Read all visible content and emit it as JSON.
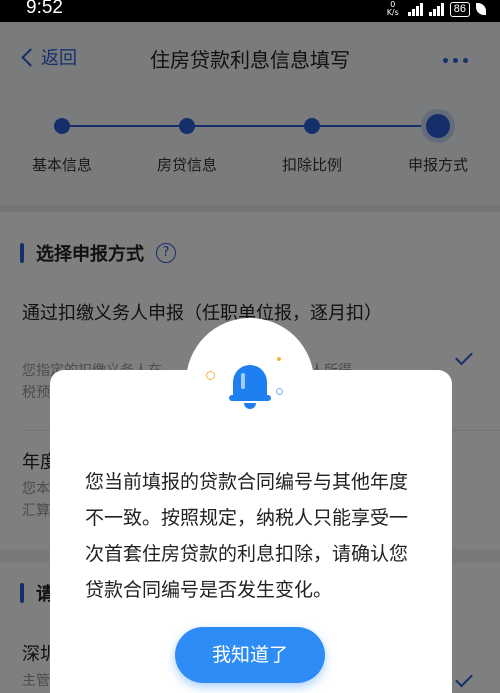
{
  "status_bar": {
    "time": "9:52",
    "net_speed_value": "0",
    "net_speed_unit": "K/s",
    "battery": "86"
  },
  "header": {
    "back_label": "返回",
    "title": "住房贷款利息信息填写"
  },
  "steps": [
    {
      "label": "基本信息",
      "state": "done"
    },
    {
      "label": "房贷信息",
      "state": "done"
    },
    {
      "label": "扣除比例",
      "state": "done"
    },
    {
      "label": "申报方式",
      "state": "current"
    }
  ],
  "section1": {
    "title": "选择申报方式",
    "help_glyph": "?"
  },
  "option1": {
    "title": "通过扣缴义务人申报（任职单位报，逐月扣）",
    "desc_line1": "您指定的扣缴义务人在",
    "desc_line1_end": "算个人所得",
    "desc_line2": "税预"
  },
  "option2": {
    "title_fragment": "年度",
    "desc_line1": "您本",
    "desc_line2": "汇算"
  },
  "section2": {
    "title_fragment": "请"
  },
  "option3": {
    "title_fragment": "深圳",
    "desc_fragment": "主管"
  },
  "dialog": {
    "message": "您当前填报的贷款合同编号与其他年度不一致。按照规定，纳税人只能享受一次首套住房贷款的利息扣除，请确认您贷款合同编号是否发生变化。",
    "ok_label": "我知道了"
  },
  "colors": {
    "primary": "#2a5fd6",
    "button": "#2e8cf6",
    "bell": "#1e7ff0"
  }
}
